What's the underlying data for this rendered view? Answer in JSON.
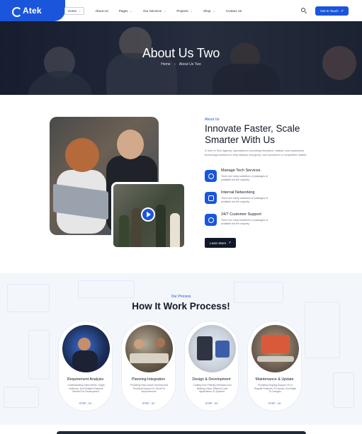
{
  "header": {
    "logo": "Atek",
    "nav": [
      {
        "label": "Home",
        "has_dropdown": true,
        "active": true
      },
      {
        "label": "About Us",
        "has_dropdown": false,
        "active": false
      },
      {
        "label": "Pages",
        "has_dropdown": true,
        "active": false
      },
      {
        "label": "Our Services",
        "has_dropdown": true,
        "active": false
      },
      {
        "label": "Projects",
        "has_dropdown": true,
        "active": false
      },
      {
        "label": "Shop",
        "has_dropdown": true,
        "active": false
      },
      {
        "label": "Contact Us",
        "has_dropdown": false,
        "active": false
      }
    ],
    "cta_label": "Get In Touch",
    "cta_arrow": "↗",
    "chevron": "⌄"
  },
  "hero": {
    "title": "About Us Two",
    "breadcrumb_home": "Home",
    "breadcrumb_sep": "›",
    "breadcrumb_current": "About Us Two"
  },
  "about": {
    "eyebrow": "About Us",
    "title": "Innovate Faster, Scale Smarter With Us",
    "description": "A Tech of Tech Agency, specializes in providing innovative, reliable, and customized technology solutions to help startups and group, and succeed in a competitive market.",
    "features": [
      {
        "title": "Manage Tech Services",
        "description": "There are many variations of passages of available but the majority.",
        "icon": "gear-icon"
      },
      {
        "title": "Internal Networking",
        "description": "There are many variations of passages of available but the majority.",
        "icon": "network-icon"
      },
      {
        "title": "24/7 Customer Support",
        "description": "There are many variations of passages of available but the majority.",
        "icon": "headset-icon"
      }
    ],
    "button_label": "Learn More",
    "button_arrow": "↗"
  },
  "process": {
    "eyebrow": "Our Process",
    "title": "How It Work Process!",
    "steps": [
      {
        "title": "Requirement Analysis",
        "description": "Understanding Client Needs, Target Audience, And Detailed Features Needed For Development.",
        "step": "STEP - 01"
      },
      {
        "title": "Planning Integration",
        "description": "Providing Post-Launch Services And Technical Support To Client For Improvements.",
        "step": "STEP - 02"
      },
      {
        "title": "Design & Development",
        "description": "Crafting User Friendly Interfaces And Building Clean, Efficient Code Applications Or Systems.",
        "step": "STEP - 03"
      },
      {
        "title": "Maintenance & Update",
        "description": "Providing Ongoing Support, Fix & Regular Features, Fix Issues, And Adapt To Changes.",
        "step": "STEP - 04"
      }
    ]
  },
  "colors": {
    "accent": "#1a56db",
    "dark": "#111827",
    "section_bg": "#f3f6fb"
  }
}
